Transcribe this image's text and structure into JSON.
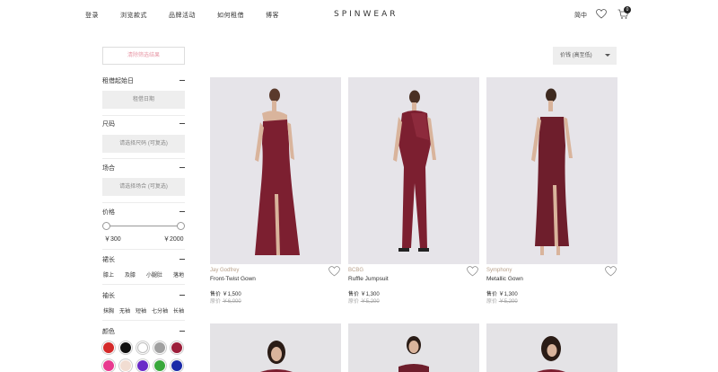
{
  "header": {
    "nav": [
      "登录",
      "浏览款式",
      "品牌活动",
      "如何租借",
      "博客"
    ],
    "logo": "SPINWEAR",
    "lang": "简中",
    "cart_count": "0"
  },
  "sidebar": {
    "clear_label": "清除筛选结果",
    "rent_date_title": "租借起始日",
    "rent_date_button": "租借日期",
    "size_title": "尺码",
    "size_placeholder": "请选择尺码 (可复选)",
    "occasion_title": "场合",
    "occasion_placeholder": "请选择场合 (可复选)",
    "price_title": "价格",
    "price_min": "￥300",
    "price_max": "￥2000",
    "length_title": "裙长",
    "length_options": [
      "膝上",
      "及膝",
      "小腿肚",
      "落地"
    ],
    "sleeve_title": "袖长",
    "sleeve_options": [
      "抹胸",
      "无袖",
      "短袖",
      "七分袖",
      "长袖"
    ],
    "color_title": "颜色"
  },
  "colors": [
    "#d42a2a",
    "#111111",
    "#ffffff",
    "#a0a0a0",
    "#9c1f3a",
    "#e83a8f",
    "#f1ddd2",
    "#6a2bc8",
    "#39a83b",
    "#1a2aa8"
  ],
  "sort": {
    "label": "价钱 (高至低)"
  },
  "products": [
    {
      "brand": "Jay Godfrey",
      "name": "Front-Twist Gown",
      "rent": "售价 ￥1,500",
      "orig_label": "原价",
      "orig": "￥6,000"
    },
    {
      "brand": "BCBG",
      "name": "Ruffle Jumpsuit",
      "rent": "售价 ￥1,300",
      "orig_label": "原价",
      "orig": "￥5,200"
    },
    {
      "brand": "Symphony",
      "name": "Metallic Gown",
      "rent": "售价 ￥1,300",
      "orig_label": "原价",
      "orig": "￥5,200"
    }
  ]
}
